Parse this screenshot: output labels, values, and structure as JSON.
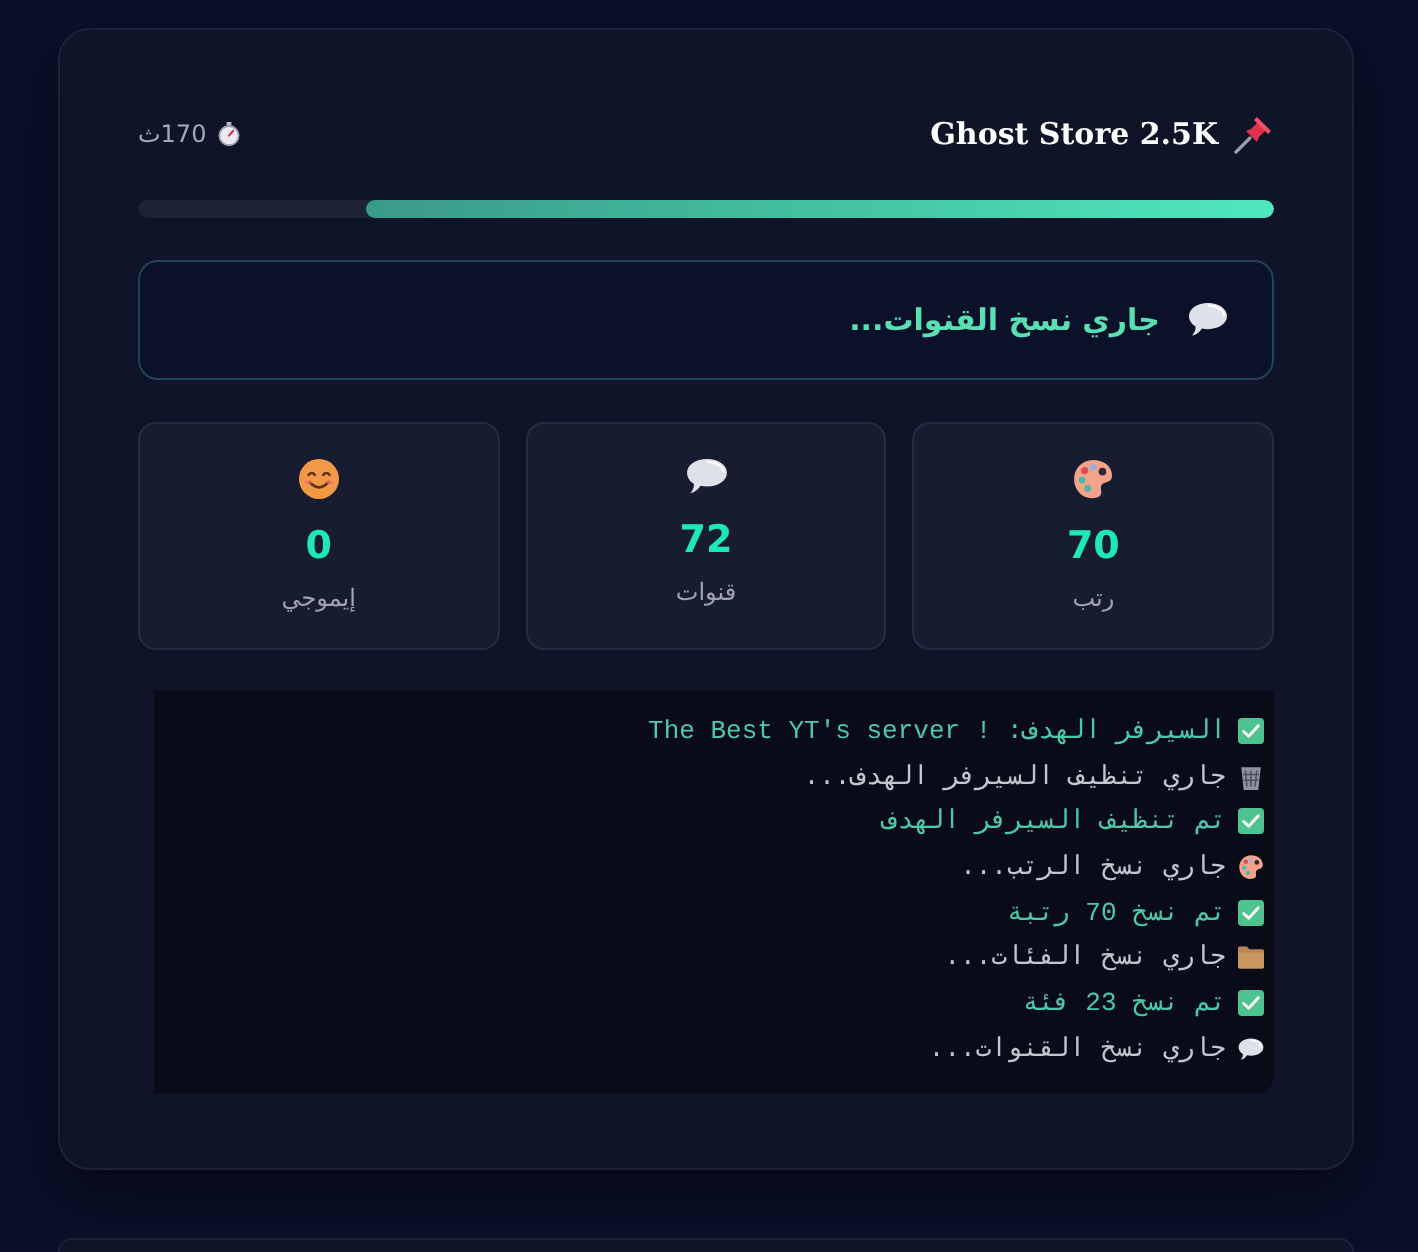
{
  "header": {
    "title": "Ghost Store 2.5K",
    "timer": "170ث"
  },
  "progress": {
    "level": 0.8
  },
  "status": {
    "kind": "channels",
    "text": "جاري نسخ القنوات..."
  },
  "stats": [
    {
      "kind": "roles",
      "value": "70",
      "label": "رتب"
    },
    {
      "kind": "channels",
      "value": "72",
      "label": "قنوات"
    },
    {
      "kind": "emoji",
      "value": "0",
      "label": "إيموجي"
    }
  ],
  "log": [
    {
      "kind": "done",
      "text": "السيرفر الهدف: ! The Best YT's server"
    },
    {
      "kind": "clean",
      "text": "جاري تنظيف السيرفر الهدف..."
    },
    {
      "kind": "done",
      "text": "تم تنظيف السيرفر الهدف"
    },
    {
      "kind": "roles",
      "text": "جاري نسخ الرتب..."
    },
    {
      "kind": "done",
      "text": "تم نسخ 70 رتبة"
    },
    {
      "kind": "categories",
      "text": "جاري نسخ الفئات..."
    },
    {
      "kind": "done",
      "text": "تم نسخ 23 فئة"
    },
    {
      "kind": "channels",
      "text": "جاري نسخ القنوات..."
    }
  ]
}
